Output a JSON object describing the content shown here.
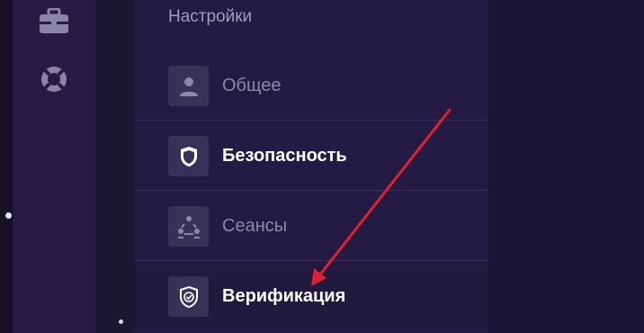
{
  "settings": {
    "title": "Настройки",
    "items": [
      {
        "label": "Общее",
        "icon": "user-icon",
        "active": false
      },
      {
        "label": "Безопасность",
        "icon": "shield-icon",
        "active": true
      },
      {
        "label": "Сеансы",
        "icon": "sessions-icon",
        "active": false
      },
      {
        "label": "Верификация",
        "icon": "shield-check-icon",
        "active": true
      }
    ]
  },
  "rail": {
    "icons": [
      "briefcase-icon",
      "lifebuoy-icon"
    ]
  },
  "colors": {
    "background": "#1b1530",
    "panel": "#241b45",
    "rail": "#251b44",
    "icon_box": "#3a3158",
    "arrow": "#e0212e",
    "active_text": "#ffffff",
    "inactive_text": "#8f87a8"
  }
}
